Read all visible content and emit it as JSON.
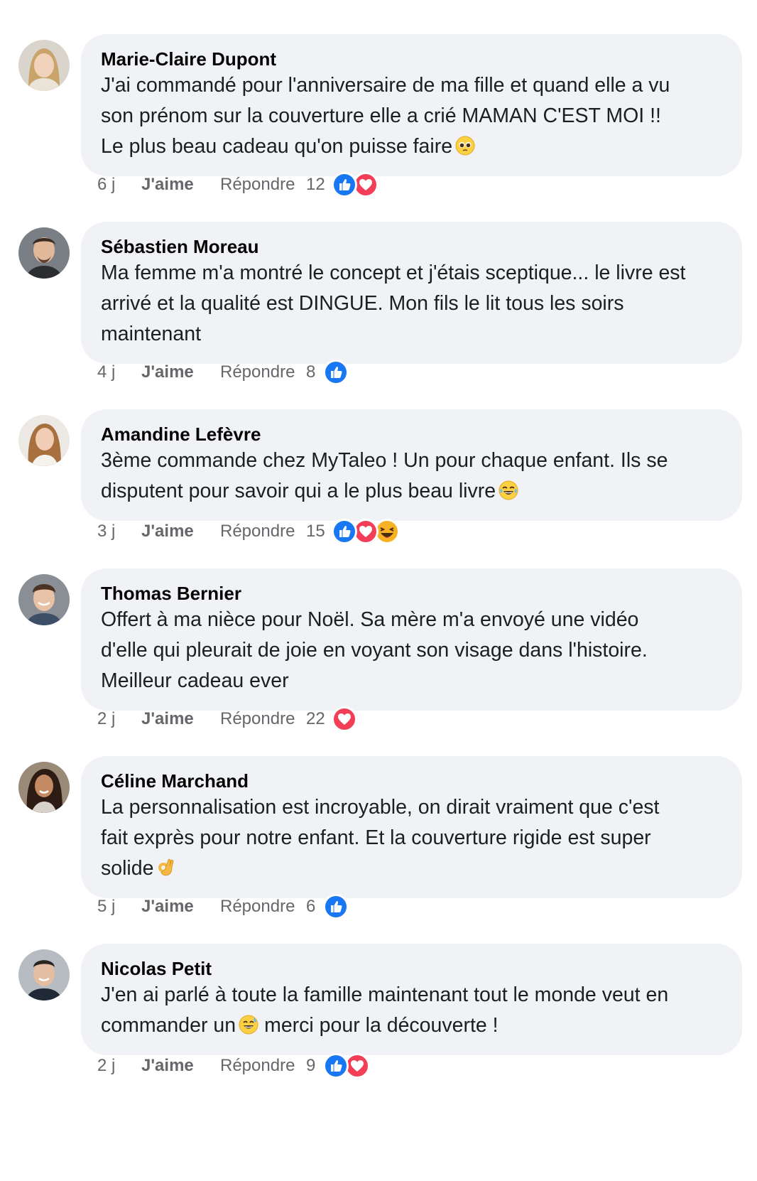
{
  "comments": [
    {
      "author": "Marie-Claire Dupont",
      "lines": [
        "J'ai commandé pour l'anniversaire de ma fille et quand elle a vu",
        "son prénom sur la couverture elle a crié MAMAN C'EST MOI !!",
        "Le plus beau cadeau qu'on puisse faire"
      ],
      "emoji": "pleading-face-emoji",
      "time": "6 j",
      "like_label": "J'aime",
      "reply_label": "Répondre",
      "reaction_count": "12",
      "reactions": [
        "like",
        "love"
      ],
      "avatar_colors": {
        "hair": "#c9a46a",
        "skin": "#f1d2bb",
        "bg": "#d9d4cc"
      }
    },
    {
      "author": "Sébastien Moreau",
      "lines": [
        "Ma femme m'a montré le concept et j'étais sceptique... le livre est",
        "arrivé et la qualité est DINGUE. Mon fils le lit tous les soirs",
        "maintenant"
      ],
      "emoji": "",
      "time": "4 j",
      "like_label": "J'aime",
      "reply_label": "Répondre",
      "reaction_count": "8",
      "reactions": [
        "like"
      ],
      "avatar_colors": {
        "hair": "#3b2b22",
        "skin": "#e2b89b",
        "bg": "#7a7f86"
      }
    },
    {
      "author": "Amandine Lefèvre",
      "lines": [
        "3ème commande chez MyTaleo ! Un pour chaque enfant. Ils se",
        "disputent pour savoir qui a le plus beau livre"
      ],
      "emoji": "laughing-tears-emoji",
      "time": "3 j",
      "like_label": "J'aime",
      "reply_label": "Répondre",
      "reaction_count": "15",
      "reactions": [
        "like",
        "love",
        "haha"
      ],
      "avatar_colors": {
        "hair": "#a86f3f",
        "skin": "#f0cdb4",
        "bg": "#ece8e3"
      }
    },
    {
      "author": "Thomas Bernier",
      "lines": [
        "Offert à ma nièce pour Noël. Sa mère m'a envoyé une vidéo",
        "d'elle qui pleurait de joie en voyant son visage dans l'histoire.",
        "Meilleur cadeau ever"
      ],
      "emoji": "",
      "time": "2 j",
      "like_label": "J'aime",
      "reply_label": "Répondre",
      "reaction_count": "22",
      "reactions": [
        "love"
      ],
      "avatar_colors": {
        "hair": "#4a3324",
        "skin": "#e8c2a6",
        "bg": "#8a8f95"
      }
    },
    {
      "author": "Céline Marchand",
      "lines": [
        "La personnalisation est incroyable, on dirait vraiment que c'est",
        "fait exprès pour notre enfant. Et la couverture rigide est super",
        "solide"
      ],
      "emoji": "ok-hand-emoji",
      "time": "5 j",
      "like_label": "J'aime",
      "reply_label": "Répondre",
      "reaction_count": "6",
      "reactions": [
        "like"
      ],
      "avatar_colors": {
        "hair": "#2e1c14",
        "skin": "#c48a63",
        "bg": "#9a8a78"
      }
    },
    {
      "author": "Nicolas Petit",
      "lines": [
        "J'en ai parlé à toute la famille maintenant tout le monde veut en",
        "commander un",
        "merci pour la découverte !"
      ],
      "emoji": "grinning-sweat-emoji",
      "time": "2 j",
      "like_label": "J'aime",
      "reply_label": "Répondre",
      "reaction_count": "9",
      "reactions": [
        "like",
        "love"
      ],
      "avatar_colors": {
        "hair": "#2a2521",
        "skin": "#e4bea2",
        "bg": "#b7bcc2"
      }
    }
  ],
  "colors": {
    "bubble": "#f0f2f5",
    "meta_text": "#65676b",
    "like_blue": "#1877f2",
    "love_red": "#f33e58",
    "haha_yellow": "#f7b125"
  }
}
